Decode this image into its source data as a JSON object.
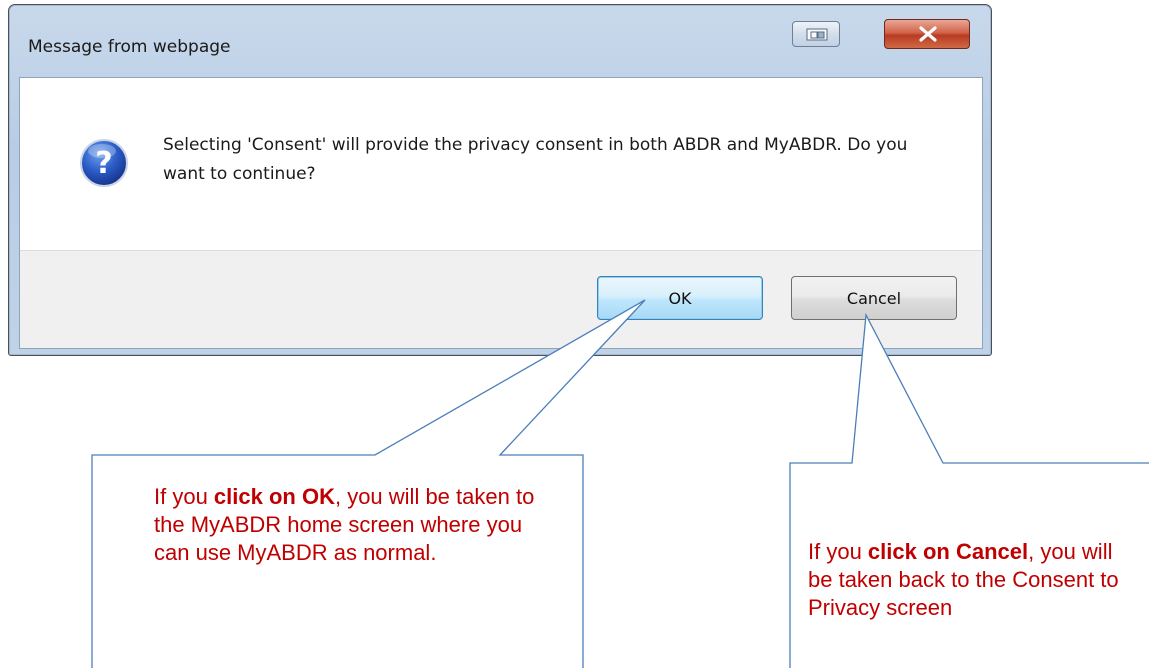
{
  "window": {
    "title": "Message from webpage"
  },
  "dialog": {
    "message": "Selecting 'Consent' will provide the privacy consent in both ABDR and MyABDR. Do you want to continue?",
    "icon": "question-icon",
    "ok_label": "OK",
    "cancel_label": "Cancel"
  },
  "callout_ok": {
    "prefix": "If you ",
    "bold": "click on OK",
    "suffix": ", you will be taken to the MyABDR home screen where you can use MyABDR as normal."
  },
  "callout_cancel": {
    "prefix": "If you ",
    "bold": "click on Cancel",
    "suffix": ", you will be taken back to the Consent to Privacy screen"
  },
  "colors": {
    "callout_text": "#c00000",
    "callout_border": "#4a7ebb",
    "ok_border": "#3c7fb1",
    "close_button": "#c8442a"
  }
}
